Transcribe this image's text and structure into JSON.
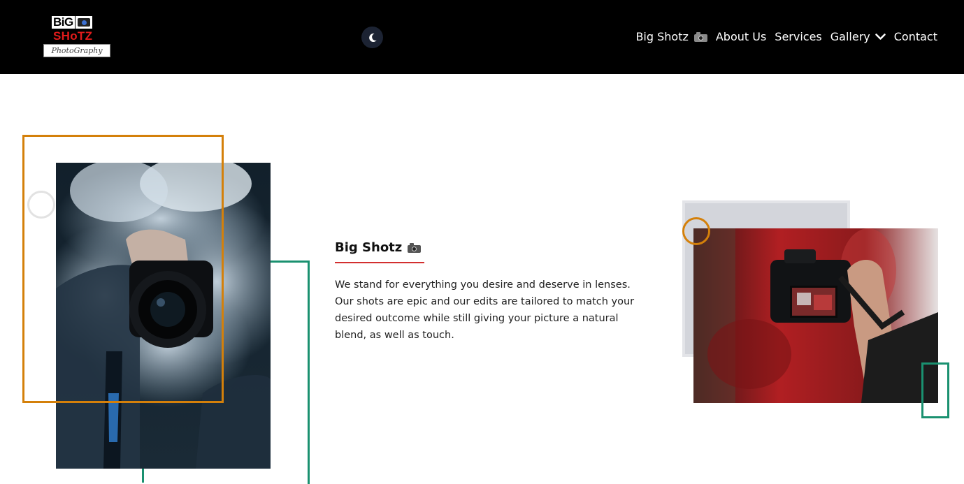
{
  "header": {
    "logo": {
      "line1": "BiG",
      "line2": "SHoTZ",
      "line3": "PhotoGraphy"
    },
    "theme_toggle_icon": "moon-icon",
    "nav": {
      "brand_label": "Big Shotz",
      "about_label": "About Us",
      "services_label": "Services",
      "gallery_label": "Gallery",
      "contact_label": "Contact"
    }
  },
  "main": {
    "title": "Big Shotz",
    "description": "We stand for everything you desire and deserve in lenses. Our shots are epic and our edits are tailored to match your desired outcome while still giving your picture a natural blend, as well as touch.",
    "left_image_icon": "camera-in-smoke-photo",
    "right_image_icon": "camera-screen-photo"
  },
  "colors": {
    "header_bg": "#000000",
    "accent_orange": "#d4800a",
    "accent_green": "#1a9170",
    "underline_red": "#d32f2f",
    "logo_red": "#e21b1b"
  }
}
